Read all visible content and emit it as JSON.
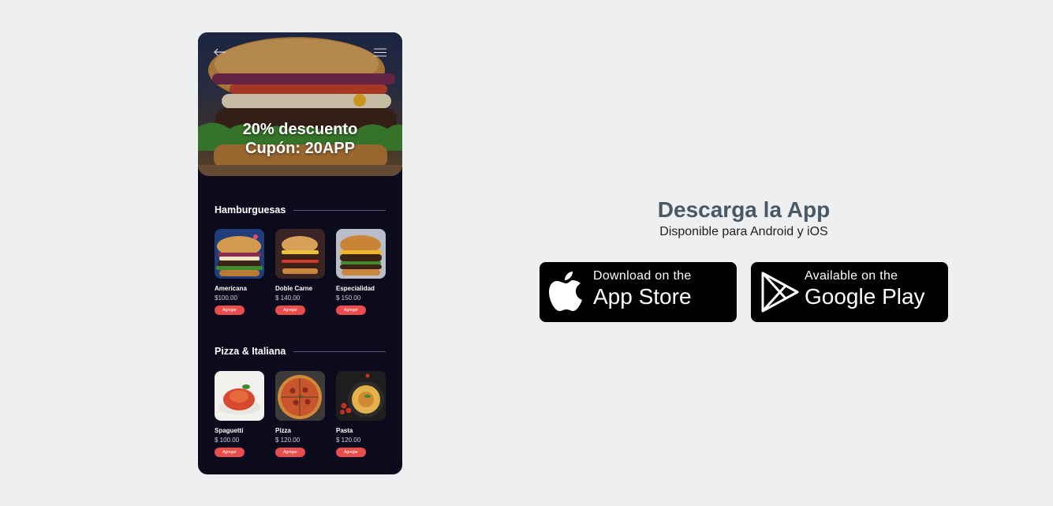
{
  "promo": {
    "line1": "20% descuento",
    "line2": "Cupón: 20APP"
  },
  "sections": [
    {
      "title": "Hamburguesas",
      "items": [
        {
          "name": "Americana",
          "price": "$100.00",
          "button": "Agregar"
        },
        {
          "name": "Doble Carne",
          "price": "$ 140.00",
          "button": "Agregar"
        },
        {
          "name": "Especialidad",
          "price": "$ 150.00",
          "button": "Agregar"
        }
      ]
    },
    {
      "title": "Pizza & Italiana",
      "items": [
        {
          "name": "Spaguetti",
          "price": "$ 100.00",
          "button": "Agregar"
        },
        {
          "name": "Pizza",
          "price": "$ 120.00",
          "button": "Agregar"
        },
        {
          "name": "Pasta",
          "price": "$ 120.00",
          "button": "Agregar"
        }
      ]
    }
  ],
  "download": {
    "title": "Descarga la App",
    "subtitle": "Disponible para Android y iOS",
    "app_store": {
      "small": "Download on the",
      "big": "App Store",
      "icon": "apple-icon"
    },
    "google_play": {
      "small": "Available on the",
      "big": "Google Play",
      "icon": "play-icon"
    }
  },
  "icons": {
    "back": "arrow-left-icon",
    "menu": "hamburger-menu-icon"
  },
  "colors": {
    "page_bg": "#eeeff1",
    "phone_bg": "#0b0b1d",
    "accent_button": "#e94e4e",
    "title_color": "#475866"
  }
}
